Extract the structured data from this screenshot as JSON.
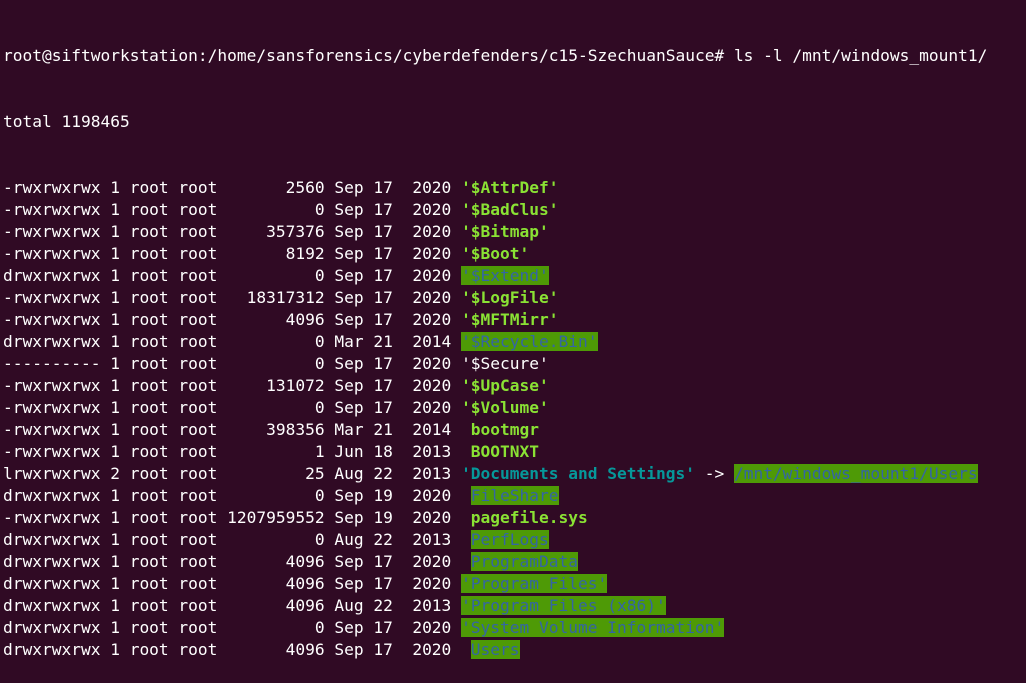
{
  "terminal": {
    "prompt": "root@siftworkstation:/home/sansforensics/cyberdefenders/c15-SzechuanSauce# ",
    "command": "ls -l /mnt/windows_mount1/",
    "total": "total 1198465",
    "entries": [
      {
        "meta": "-rwxrwxrwx 1 root root       2560 Sep 17  2020 ",
        "name": "'$AttrDef'",
        "style": "fname"
      },
      {
        "meta": "-rwxrwxrwx 1 root root          0 Sep 17  2020 ",
        "name": "'$BadClus'",
        "style": "fname"
      },
      {
        "meta": "-rwxrwxrwx 1 root root     357376 Sep 17  2020 ",
        "name": "'$Bitmap'",
        "style": "fname"
      },
      {
        "meta": "-rwxrwxrwx 1 root root       8192 Sep 17  2020 ",
        "name": "'$Boot'",
        "style": "fname"
      },
      {
        "meta": "drwxrwxrwx 1 root root          0 Sep 17  2020 ",
        "name": "'$Extend'",
        "style": "dirhl"
      },
      {
        "meta": "-rwxrwxrwx 1 root root   18317312 Sep 17  2020 ",
        "name": "'$LogFile'",
        "style": "fname"
      },
      {
        "meta": "-rwxrwxrwx 1 root root       4096 Sep 17  2020 ",
        "name": "'$MFTMirr'",
        "style": "fname"
      },
      {
        "meta": "drwxrwxrwx 1 root root          0 Mar 21  2014 ",
        "name": "'$Recycle.Bin'",
        "style": "dirhl"
      },
      {
        "meta": "---------- 1 root root          0 Sep 17  2020 ",
        "name": "'$Secure'",
        "style": "plain"
      },
      {
        "meta": "-rwxrwxrwx 1 root root     131072 Sep 17  2020 ",
        "name": "'$UpCase'",
        "style": "fname"
      },
      {
        "meta": "-rwxrwxrwx 1 root root          0 Sep 17  2020 ",
        "name": "'$Volume'",
        "style": "fname"
      },
      {
        "meta": "-rwxrwxrwx 1 root root     398356 Mar 21  2014  ",
        "name": "bootmgr",
        "style": "exec"
      },
      {
        "meta": "-rwxrwxrwx 1 root root          1 Jun 18  2013  ",
        "name": "BOOTNXT",
        "style": "exec"
      },
      {
        "meta": "lrwxrwxrwx 2 root root         25 Aug 22  2013 ",
        "name": "'Documents and Settings'",
        "style": "link",
        "arrow": " -> ",
        "target": "/mnt/windows_mount1/Users"
      },
      {
        "meta": "drwxrwxrwx 1 root root          0 Sep 19  2020  ",
        "name": "FileShare",
        "style": "dirhl"
      },
      {
        "meta": "-rwxrwxrwx 1 root root 1207959552 Sep 19  2020  ",
        "name": "pagefile.sys",
        "style": "exec"
      },
      {
        "meta": "drwxrwxrwx 1 root root          0 Aug 22  2013  ",
        "name": "PerfLogs",
        "style": "dirhl"
      },
      {
        "meta": "drwxrwxrwx 1 root root       4096 Sep 17  2020  ",
        "name": "ProgramData",
        "style": "dirhl"
      },
      {
        "meta": "drwxrwxrwx 1 root root       4096 Sep 17  2020 ",
        "name": "'Program Files'",
        "style": "dirhl"
      },
      {
        "meta": "drwxrwxrwx 1 root root       4096 Aug 22  2013 ",
        "name": "'Program Files (x86)'",
        "style": "dirhl"
      },
      {
        "meta": "drwxrwxrwx 1 root root          0 Sep 17  2020 ",
        "name": "'System Volume Information'",
        "style": "dirhl"
      },
      {
        "meta": "drwxrwxrwx 1 root root       4096 Sep 17  2020  ",
        "name": "Users",
        "style": "dirhl"
      }
    ]
  },
  "colors": {
    "background": "#300a24",
    "text": "#ffffff",
    "file_green": "#8ae234",
    "dir_highlight_bg": "#4e9a06",
    "dir_highlight_fg": "#3465a4",
    "link_cyan": "#06989a"
  }
}
